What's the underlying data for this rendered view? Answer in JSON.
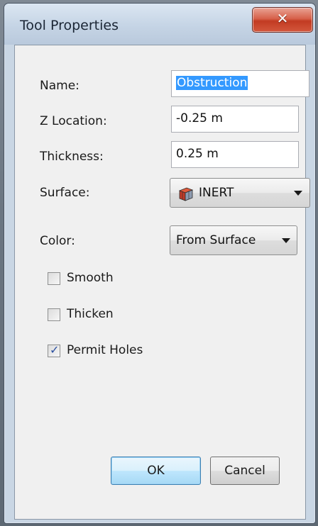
{
  "window": {
    "title": "Tool Properties",
    "close_glyph": "✕"
  },
  "form": {
    "name_label": "Name:",
    "name_value": "Obstruction",
    "z_location_label": "Z Location:",
    "z_location_value": "-0.25 m",
    "thickness_label": "Thickness:",
    "thickness_value": "0.25 m",
    "surface_label": "Surface:",
    "surface_value": "INERT",
    "color_label": "Color:",
    "color_value": "From Surface"
  },
  "options": {
    "smooth": {
      "label": "Smooth",
      "checked": false
    },
    "thicken": {
      "label": "Thicken",
      "checked": false
    },
    "permit_holes": {
      "label": "Permit Holes",
      "checked": true
    }
  },
  "buttons": {
    "ok": "OK",
    "cancel": "Cancel"
  },
  "icons": {
    "surface": "surface-box-icon",
    "dropdown": "chevron-down-icon",
    "close": "close-icon",
    "check": "check-icon"
  },
  "colors": {
    "selection": "#3399ff",
    "close_button": "#c23b22",
    "default_button_border": "#3c7fb1"
  }
}
